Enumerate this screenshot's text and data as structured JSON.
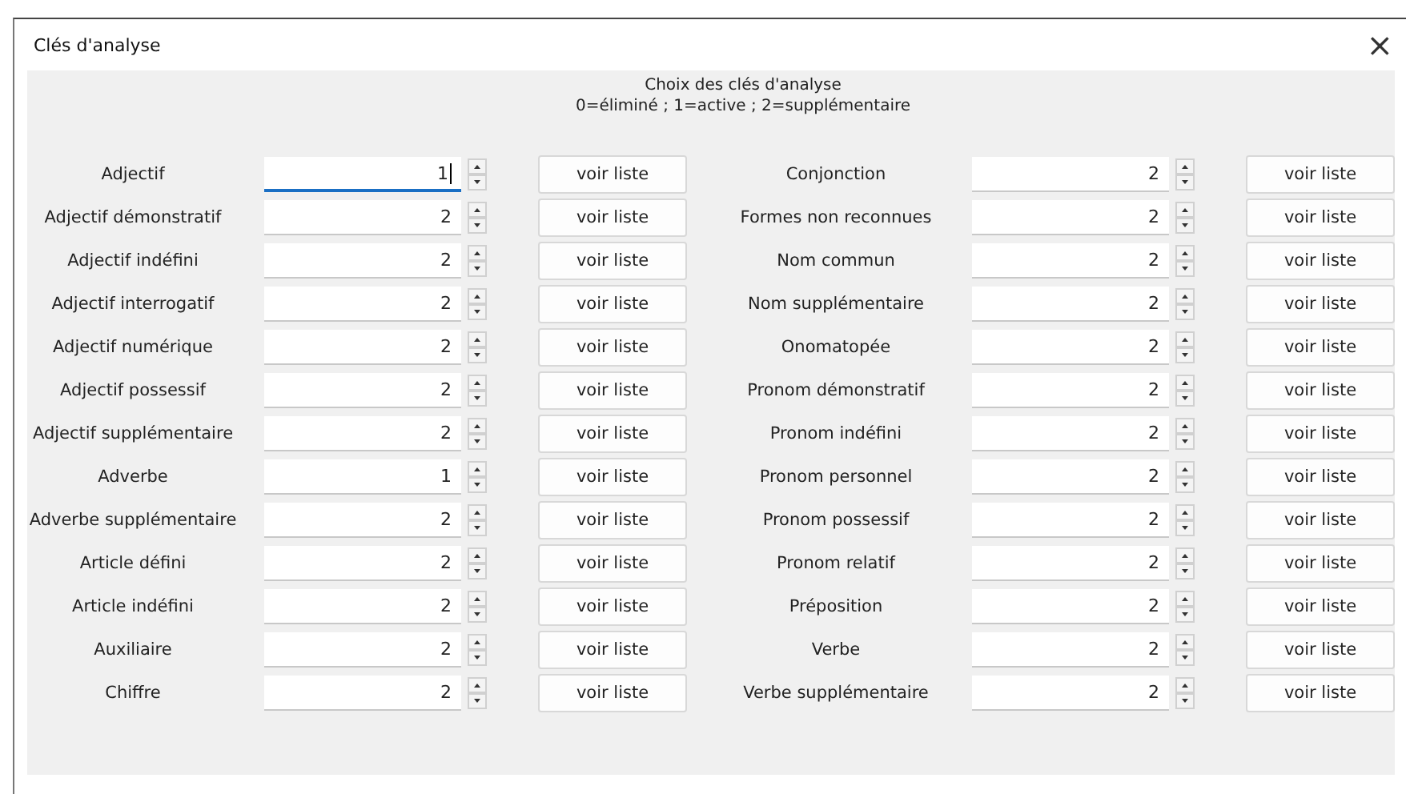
{
  "window": {
    "title": "Clés d'analyse",
    "close": "×"
  },
  "header": {
    "title": "Choix des clés d'analyse",
    "legend": "0=éliminé ; 1=active ; 2=supplémentaire"
  },
  "columns": [
    {
      "rows": [
        {
          "label": "Adjectif",
          "value": "1",
          "focused": true,
          "button": "voir liste"
        },
        {
          "label": "Adjectif démonstratif",
          "value": "2",
          "focused": false,
          "button": "voir liste"
        },
        {
          "label": "Adjectif indéfini",
          "value": "2",
          "focused": false,
          "button": "voir liste"
        },
        {
          "label": "Adjectif interrogatif",
          "value": "2",
          "focused": false,
          "button": "voir liste"
        },
        {
          "label": "Adjectif numérique",
          "value": "2",
          "focused": false,
          "button": "voir liste"
        },
        {
          "label": "Adjectif possessif",
          "value": "2",
          "focused": false,
          "button": "voir liste"
        },
        {
          "label": "Adjectif supplémentaire",
          "value": "2",
          "focused": false,
          "button": "voir liste"
        },
        {
          "label": "Adverbe",
          "value": "1",
          "focused": false,
          "button": "voir liste"
        },
        {
          "label": "Adverbe supplémentaire",
          "value": "2",
          "focused": false,
          "button": "voir liste"
        },
        {
          "label": "Article défini",
          "value": "2",
          "focused": false,
          "button": "voir liste"
        },
        {
          "label": "Article indéfini",
          "value": "2",
          "focused": false,
          "button": "voir liste"
        },
        {
          "label": "Auxiliaire",
          "value": "2",
          "focused": false,
          "button": "voir liste"
        },
        {
          "label": "Chiffre",
          "value": "2",
          "focused": false,
          "button": "voir liste"
        }
      ]
    },
    {
      "rows": [
        {
          "label": "Conjonction",
          "value": "2",
          "focused": false,
          "button": "voir liste"
        },
        {
          "label": "Formes non reconnues",
          "value": "2",
          "focused": false,
          "button": "voir liste"
        },
        {
          "label": "Nom commun",
          "value": "2",
          "focused": false,
          "button": "voir liste"
        },
        {
          "label": "Nom supplémentaire",
          "value": "2",
          "focused": false,
          "button": "voir liste"
        },
        {
          "label": "Onomatopée",
          "value": "2",
          "focused": false,
          "button": "voir liste"
        },
        {
          "label": "Pronom démonstratif",
          "value": "2",
          "focused": false,
          "button": "voir liste"
        },
        {
          "label": "Pronom indéfini",
          "value": "2",
          "focused": false,
          "button": "voir liste"
        },
        {
          "label": "Pronom personnel",
          "value": "2",
          "focused": false,
          "button": "voir liste"
        },
        {
          "label": "Pronom possessif",
          "value": "2",
          "focused": false,
          "button": "voir liste"
        },
        {
          "label": "Pronom relatif",
          "value": "2",
          "focused": false,
          "button": "voir liste"
        },
        {
          "label": "Préposition",
          "value": "2",
          "focused": false,
          "button": "voir liste"
        },
        {
          "label": "Verbe",
          "value": "2",
          "focused": false,
          "button": "voir liste"
        },
        {
          "label": "Verbe supplémentaire",
          "value": "2",
          "focused": false,
          "button": "voir liste"
        }
      ]
    }
  ]
}
